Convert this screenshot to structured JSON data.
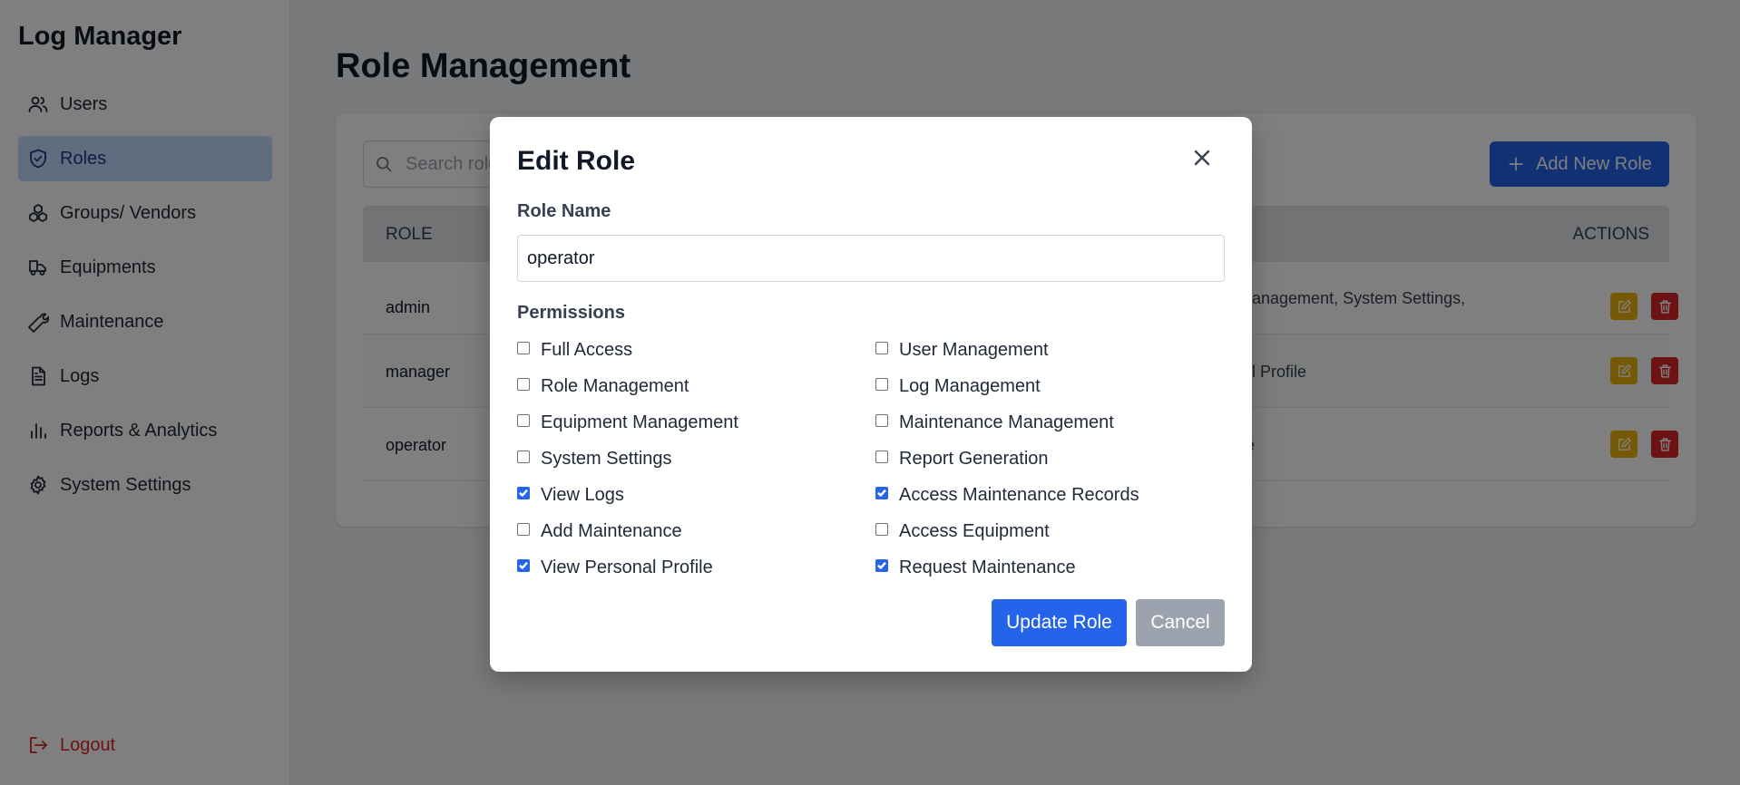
{
  "app": {
    "title": "Log Manager"
  },
  "sidebar": {
    "items": [
      {
        "label": "Users",
        "icon": "users-icon",
        "active": false
      },
      {
        "label": "Roles",
        "icon": "shield-icon",
        "active": true
      },
      {
        "label": "Groups/ Vendors",
        "icon": "groups-icon",
        "active": false
      },
      {
        "label": "Equipments",
        "icon": "truck-icon",
        "active": false
      },
      {
        "label": "Maintenance",
        "icon": "wrench-icon",
        "active": false
      },
      {
        "label": "Logs",
        "icon": "document-icon",
        "active": false
      },
      {
        "label": "Reports & Analytics",
        "icon": "bar-chart-icon",
        "active": false
      },
      {
        "label": "System Settings",
        "icon": "gear-icon",
        "active": false
      }
    ],
    "logout_label": "Logout"
  },
  "main": {
    "page_title": "Role Management",
    "search_placeholder": "Search role",
    "add_button_label": "Add New Role",
    "table": {
      "columns": {
        "role": "ROLE",
        "actions": "ACTIONS"
      },
      "rows": [
        {
          "name": "admin",
          "permissions_visible": "e Management, System Settings,"
        },
        {
          "name": "manager",
          "permissions_visible": "onal Profile"
        },
        {
          "name": "operator",
          "permissions_visible": "ofile"
        }
      ]
    }
  },
  "modal": {
    "title": "Edit Role",
    "role_name_label": "Role Name",
    "role_name_value": "operator",
    "permissions_label": "Permissions",
    "permissions": [
      {
        "label": "Full Access",
        "checked": false
      },
      {
        "label": "User Management",
        "checked": false
      },
      {
        "label": "Role Management",
        "checked": false
      },
      {
        "label": "Log Management",
        "checked": false
      },
      {
        "label": "Equipment Management",
        "checked": false
      },
      {
        "label": "Maintenance Management",
        "checked": false
      },
      {
        "label": "System Settings",
        "checked": false
      },
      {
        "label": "Report Generation",
        "checked": false
      },
      {
        "label": "View Logs",
        "checked": true
      },
      {
        "label": "Access Maintenance Records",
        "checked": true
      },
      {
        "label": "Add Maintenance",
        "checked": false
      },
      {
        "label": "Access Equipment",
        "checked": false
      },
      {
        "label": "View Personal Profile",
        "checked": true
      },
      {
        "label": "Request Maintenance",
        "checked": true
      }
    ],
    "update_label": "Update Role",
    "cancel_label": "Cancel"
  },
  "colors": {
    "primary": "#2563eb",
    "edit": "#eab308",
    "delete": "#dc2626",
    "active_nav": "#bfdbfe",
    "cancel": "#9ca3af"
  }
}
